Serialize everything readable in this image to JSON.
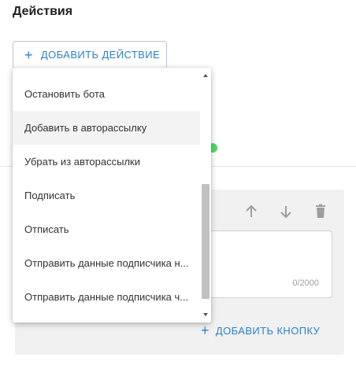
{
  "section": {
    "title": "Действия"
  },
  "toolbar": {
    "add_action_label": "ДОБАВИТЬ ДЕЙСТВИЕ"
  },
  "dropdown": {
    "items": [
      {
        "label": "Остановить бота"
      },
      {
        "label": "Добавить в авторассылку"
      },
      {
        "label": "Убрать из авторассылки"
      },
      {
        "label": "Подписать"
      },
      {
        "label": "Отписать"
      },
      {
        "label": "Отправить данные подписчика н..."
      },
      {
        "label": "Отправить данные подписчика ч..."
      }
    ]
  },
  "editor": {
    "counter": "0/2000",
    "add_button_label": "ДОБАВИТЬ КНОПКУ"
  },
  "colors": {
    "accent": "#2f80c8",
    "status_green": "#4cd964"
  }
}
